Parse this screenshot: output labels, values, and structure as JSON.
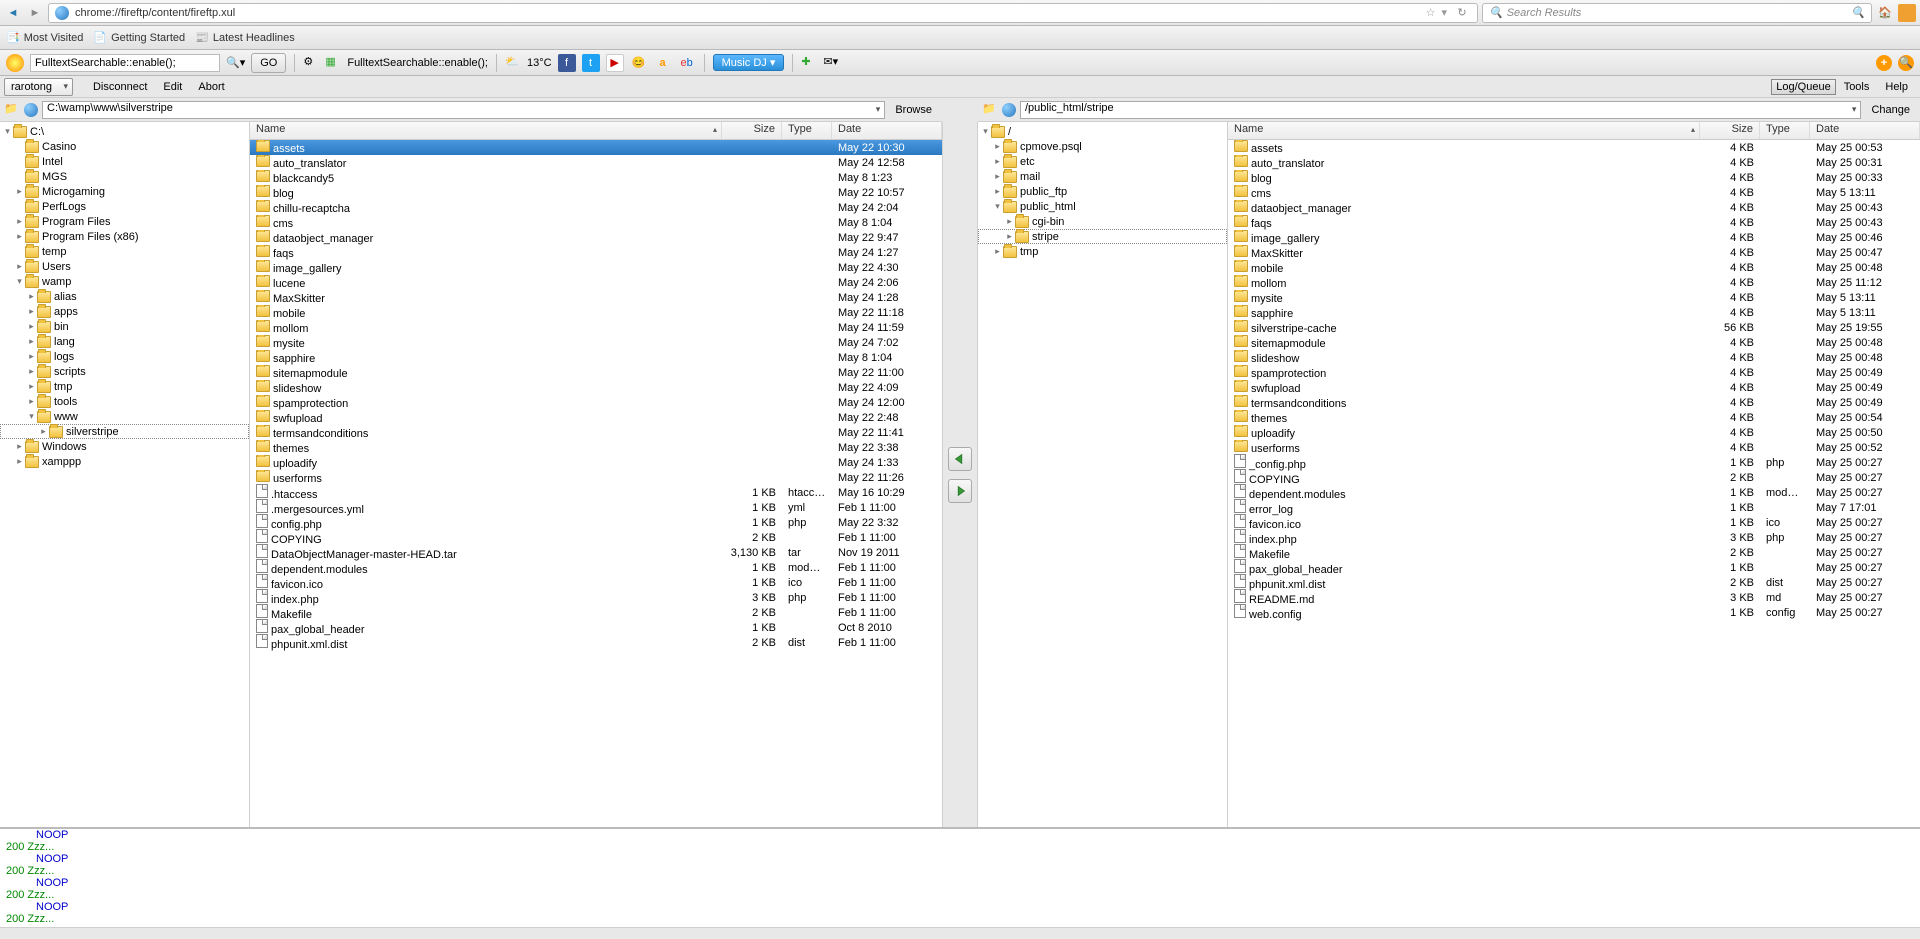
{
  "browser": {
    "url": "chrome://fireftp/content/fireftp.xul",
    "search_placeholder": "Search Results"
  },
  "bookmarks": [
    {
      "label": "Most Visited",
      "icon": "bookmark-folder"
    },
    {
      "label": "Getting Started",
      "icon": "page"
    },
    {
      "label": "Latest Headlines",
      "icon": "rss"
    }
  ],
  "toolbar3": {
    "search_value": "FulltextSearchable::enable();",
    "go_label": "GO",
    "label2": "FulltextSearchable::enable();",
    "temp": "13°C",
    "music_label": "Music DJ"
  },
  "menubar": {
    "account": "rarotong",
    "items": [
      "Disconnect",
      "Edit",
      "Abort"
    ],
    "right": [
      "Log/Queue",
      "Tools",
      "Help"
    ]
  },
  "local": {
    "path": "C:\\wamp\\www\\silverstripe",
    "browse": "Browse",
    "tree": [
      {
        "d": 0,
        "t": "▾",
        "n": "C:\\"
      },
      {
        "d": 1,
        "t": "",
        "n": "Casino"
      },
      {
        "d": 1,
        "t": "",
        "n": "Intel"
      },
      {
        "d": 1,
        "t": "",
        "n": "MGS"
      },
      {
        "d": 1,
        "t": "▸",
        "n": "Microgaming"
      },
      {
        "d": 1,
        "t": "",
        "n": "PerfLogs"
      },
      {
        "d": 1,
        "t": "▸",
        "n": "Program Files"
      },
      {
        "d": 1,
        "t": "▸",
        "n": "Program Files (x86)"
      },
      {
        "d": 1,
        "t": "",
        "n": "temp"
      },
      {
        "d": 1,
        "t": "▸",
        "n": "Users"
      },
      {
        "d": 1,
        "t": "▾",
        "n": "wamp"
      },
      {
        "d": 2,
        "t": "▸",
        "n": "alias"
      },
      {
        "d": 2,
        "t": "▸",
        "n": "apps"
      },
      {
        "d": 2,
        "t": "▸",
        "n": "bin"
      },
      {
        "d": 2,
        "t": "▸",
        "n": "lang"
      },
      {
        "d": 2,
        "t": "▸",
        "n": "logs"
      },
      {
        "d": 2,
        "t": "▸",
        "n": "scripts"
      },
      {
        "d": 2,
        "t": "▸",
        "n": "tmp"
      },
      {
        "d": 2,
        "t": "▸",
        "n": "tools"
      },
      {
        "d": 2,
        "t": "▾",
        "n": "www"
      },
      {
        "d": 3,
        "t": "▸",
        "n": "silverstripe",
        "sel": true
      },
      {
        "d": 1,
        "t": "▸",
        "n": "Windows"
      },
      {
        "d": 1,
        "t": "▸",
        "n": "xamppp"
      }
    ],
    "cols": {
      "name": "Name",
      "size": "Size",
      "type": "Type",
      "date": "Date"
    },
    "files": [
      {
        "ic": "d",
        "n": "assets",
        "s": "",
        "t": "",
        "dt": "May 22 10:30",
        "sel": true
      },
      {
        "ic": "d",
        "n": "auto_translator",
        "s": "",
        "t": "",
        "dt": "May 24 12:58"
      },
      {
        "ic": "d",
        "n": "blackcandy5",
        "s": "",
        "t": "",
        "dt": "May 8 1:23"
      },
      {
        "ic": "d",
        "n": "blog",
        "s": "",
        "t": "",
        "dt": "May 22 10:57"
      },
      {
        "ic": "d",
        "n": "chillu-recaptcha",
        "s": "",
        "t": "",
        "dt": "May 24 2:04"
      },
      {
        "ic": "d",
        "n": "cms",
        "s": "",
        "t": "",
        "dt": "May 8 1:04"
      },
      {
        "ic": "d",
        "n": "dataobject_manager",
        "s": "",
        "t": "",
        "dt": "May 22 9:47"
      },
      {
        "ic": "d",
        "n": "faqs",
        "s": "",
        "t": "",
        "dt": "May 24 1:27"
      },
      {
        "ic": "d",
        "n": "image_gallery",
        "s": "",
        "t": "",
        "dt": "May 22 4:30"
      },
      {
        "ic": "d",
        "n": "lucene",
        "s": "",
        "t": "",
        "dt": "May 24 2:06"
      },
      {
        "ic": "d",
        "n": "MaxSkitter",
        "s": "",
        "t": "",
        "dt": "May 24 1:28"
      },
      {
        "ic": "d",
        "n": "mobile",
        "s": "",
        "t": "",
        "dt": "May 22 11:18"
      },
      {
        "ic": "d",
        "n": "mollom",
        "s": "",
        "t": "",
        "dt": "May 24 11:59"
      },
      {
        "ic": "d",
        "n": "mysite",
        "s": "",
        "t": "",
        "dt": "May 24 7:02"
      },
      {
        "ic": "d",
        "n": "sapphire",
        "s": "",
        "t": "",
        "dt": "May 8 1:04"
      },
      {
        "ic": "d",
        "n": "sitemapmodule",
        "s": "",
        "t": "",
        "dt": "May 22 11:00"
      },
      {
        "ic": "d",
        "n": "slideshow",
        "s": "",
        "t": "",
        "dt": "May 22 4:09"
      },
      {
        "ic": "d",
        "n": "spamprotection",
        "s": "",
        "t": "",
        "dt": "May 24 12:00"
      },
      {
        "ic": "d",
        "n": "swfupload",
        "s": "",
        "t": "",
        "dt": "May 22 2:48"
      },
      {
        "ic": "d",
        "n": "termsandconditions",
        "s": "",
        "t": "",
        "dt": "May 22 11:41"
      },
      {
        "ic": "d",
        "n": "themes",
        "s": "",
        "t": "",
        "dt": "May 22 3:38"
      },
      {
        "ic": "d",
        "n": "uploadify",
        "s": "",
        "t": "",
        "dt": "May 24 1:33"
      },
      {
        "ic": "d",
        "n": "userforms",
        "s": "",
        "t": "",
        "dt": "May 22 11:26"
      },
      {
        "ic": "f",
        "n": ".htaccess",
        "s": "1 KB",
        "t": "htaccess",
        "dt": "May 16 10:29"
      },
      {
        "ic": "f",
        "n": ".mergesources.yml",
        "s": "1 KB",
        "t": "yml",
        "dt": "Feb 1 11:00"
      },
      {
        "ic": "f",
        "n": "config.php",
        "s": "1 KB",
        "t": "php",
        "dt": "May 22 3:32"
      },
      {
        "ic": "f",
        "n": "COPYING",
        "s": "2 KB",
        "t": "",
        "dt": "Feb 1 11:00"
      },
      {
        "ic": "f",
        "n": "DataObjectManager-master-HEAD.tar",
        "s": "3,130 KB",
        "t": "tar",
        "dt": "Nov 19 2011"
      },
      {
        "ic": "f",
        "n": "dependent.modules",
        "s": "1 KB",
        "t": "modul...",
        "dt": "Feb 1 11:00"
      },
      {
        "ic": "f",
        "n": "favicon.ico",
        "s": "1 KB",
        "t": "ico",
        "dt": "Feb 1 11:00"
      },
      {
        "ic": "f",
        "n": "index.php",
        "s": "3 KB",
        "t": "php",
        "dt": "Feb 1 11:00"
      },
      {
        "ic": "f",
        "n": "Makefile",
        "s": "2 KB",
        "t": "",
        "dt": "Feb 1 11:00"
      },
      {
        "ic": "f",
        "n": "pax_global_header",
        "s": "1 KB",
        "t": "",
        "dt": "Oct 8 2010"
      },
      {
        "ic": "f",
        "n": "phpunit.xml.dist",
        "s": "2 KB",
        "t": "dist",
        "dt": "Feb 1 11:00"
      }
    ]
  },
  "remote": {
    "path": "/public_html/stripe",
    "change": "Change",
    "tree": [
      {
        "d": 0,
        "t": "▾",
        "n": "/"
      },
      {
        "d": 1,
        "t": "▸",
        "n": "cpmove.psql"
      },
      {
        "d": 1,
        "t": "▸",
        "n": "etc"
      },
      {
        "d": 1,
        "t": "▸",
        "n": "mail"
      },
      {
        "d": 1,
        "t": "▸",
        "n": "public_ftp"
      },
      {
        "d": 1,
        "t": "▾",
        "n": "public_html"
      },
      {
        "d": 2,
        "t": "▸",
        "n": "cgi-bin"
      },
      {
        "d": 2,
        "t": "▸",
        "n": "stripe",
        "sel": true
      },
      {
        "d": 1,
        "t": "▸",
        "n": "tmp"
      }
    ],
    "cols": {
      "name": "Name",
      "size": "Size",
      "type": "Type",
      "date": "Date"
    },
    "files": [
      {
        "ic": "d",
        "n": "assets",
        "s": "4 KB",
        "t": "",
        "dt": "May 25 00:53"
      },
      {
        "ic": "d",
        "n": "auto_translator",
        "s": "4 KB",
        "t": "",
        "dt": "May 25 00:31"
      },
      {
        "ic": "d",
        "n": "blog",
        "s": "4 KB",
        "t": "",
        "dt": "May 25 00:33"
      },
      {
        "ic": "d",
        "n": "cms",
        "s": "4 KB",
        "t": "",
        "dt": "May 5 13:11"
      },
      {
        "ic": "d",
        "n": "dataobject_manager",
        "s": "4 KB",
        "t": "",
        "dt": "May 25 00:43"
      },
      {
        "ic": "d",
        "n": "faqs",
        "s": "4 KB",
        "t": "",
        "dt": "May 25 00:43"
      },
      {
        "ic": "d",
        "n": "image_gallery",
        "s": "4 KB",
        "t": "",
        "dt": "May 25 00:46"
      },
      {
        "ic": "d",
        "n": "MaxSkitter",
        "s": "4 KB",
        "t": "",
        "dt": "May 25 00:47"
      },
      {
        "ic": "d",
        "n": "mobile",
        "s": "4 KB",
        "t": "",
        "dt": "May 25 00:48"
      },
      {
        "ic": "d",
        "n": "mollom",
        "s": "4 KB",
        "t": "",
        "dt": "May 25 11:12"
      },
      {
        "ic": "d",
        "n": "mysite",
        "s": "4 KB",
        "t": "",
        "dt": "May 5 13:11"
      },
      {
        "ic": "d",
        "n": "sapphire",
        "s": "4 KB",
        "t": "",
        "dt": "May 5 13:11"
      },
      {
        "ic": "d",
        "n": "silverstripe-cache",
        "s": "56 KB",
        "t": "",
        "dt": "May 25 19:55"
      },
      {
        "ic": "d",
        "n": "sitemapmodule",
        "s": "4 KB",
        "t": "",
        "dt": "May 25 00:48"
      },
      {
        "ic": "d",
        "n": "slideshow",
        "s": "4 KB",
        "t": "",
        "dt": "May 25 00:48"
      },
      {
        "ic": "d",
        "n": "spamprotection",
        "s": "4 KB",
        "t": "",
        "dt": "May 25 00:49"
      },
      {
        "ic": "d",
        "n": "swfupload",
        "s": "4 KB",
        "t": "",
        "dt": "May 25 00:49"
      },
      {
        "ic": "d",
        "n": "termsandconditions",
        "s": "4 KB",
        "t": "",
        "dt": "May 25 00:49"
      },
      {
        "ic": "d",
        "n": "themes",
        "s": "4 KB",
        "t": "",
        "dt": "May 25 00:54"
      },
      {
        "ic": "d",
        "n": "uploadify",
        "s": "4 KB",
        "t": "",
        "dt": "May 25 00:50"
      },
      {
        "ic": "d",
        "n": "userforms",
        "s": "4 KB",
        "t": "",
        "dt": "May 25 00:52"
      },
      {
        "ic": "f",
        "n": "_config.php",
        "s": "1 KB",
        "t": "php",
        "dt": "May 25 00:27"
      },
      {
        "ic": "f",
        "n": "COPYING",
        "s": "2 KB",
        "t": "",
        "dt": "May 25 00:27"
      },
      {
        "ic": "f",
        "n": "dependent.modules",
        "s": "1 KB",
        "t": "modules",
        "dt": "May 25 00:27"
      },
      {
        "ic": "f",
        "n": "error_log",
        "s": "1 KB",
        "t": "",
        "dt": "May 7 17:01"
      },
      {
        "ic": "f",
        "n": "favicon.ico",
        "s": "1 KB",
        "t": "ico",
        "dt": "May 25 00:27"
      },
      {
        "ic": "f",
        "n": "index.php",
        "s": "3 KB",
        "t": "php",
        "dt": "May 25 00:27"
      },
      {
        "ic": "f",
        "n": "Makefile",
        "s": "2 KB",
        "t": "",
        "dt": "May 25 00:27"
      },
      {
        "ic": "f",
        "n": "pax_global_header",
        "s": "1 KB",
        "t": "",
        "dt": "May 25 00:27"
      },
      {
        "ic": "f",
        "n": "phpunit.xml.dist",
        "s": "2 KB",
        "t": "dist",
        "dt": "May 25 00:27"
      },
      {
        "ic": "f",
        "n": "README.md",
        "s": "3 KB",
        "t": "md",
        "dt": "May 25 00:27"
      },
      {
        "ic": "f",
        "n": "web.config",
        "s": "1 KB",
        "t": "config",
        "dt": "May 25 00:27"
      }
    ]
  },
  "log": [
    {
      "cls": "noop",
      "txt": "NOOP"
    },
    {
      "cls": "200",
      "txt": "200 Zzz..."
    },
    {
      "cls": "noop",
      "txt": "NOOP"
    },
    {
      "cls": "200",
      "txt": "200 Zzz..."
    },
    {
      "cls": "noop",
      "txt": "NOOP"
    },
    {
      "cls": "200",
      "txt": "200 Zzz..."
    },
    {
      "cls": "noop",
      "txt": "NOOP"
    },
    {
      "cls": "200",
      "txt": "200 Zzz..."
    }
  ]
}
